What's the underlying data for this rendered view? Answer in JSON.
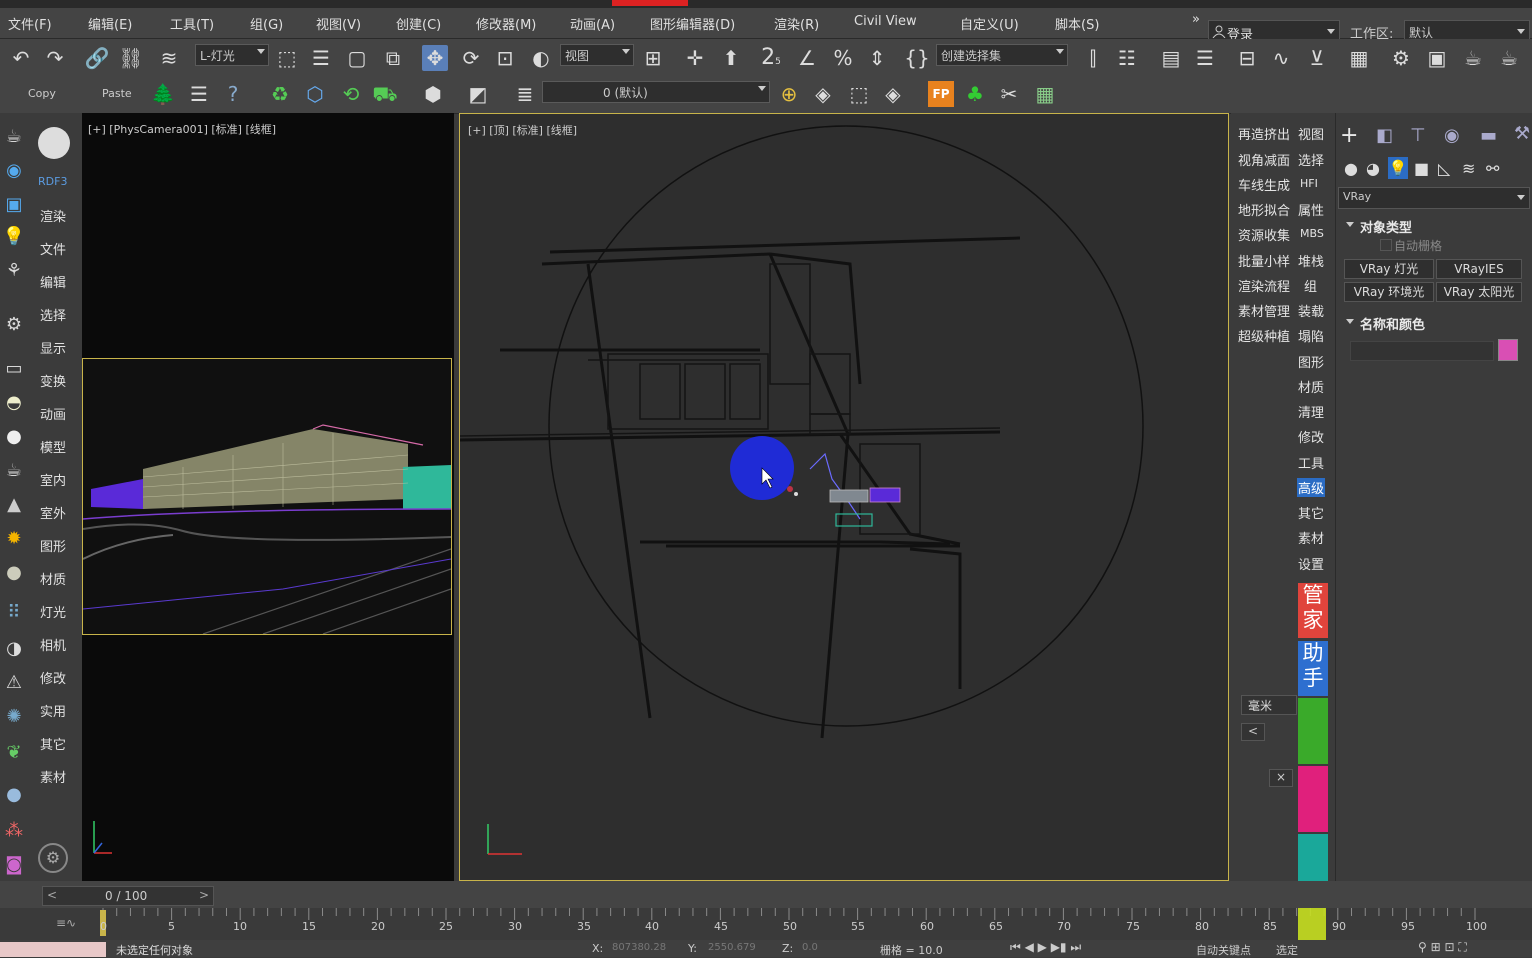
{
  "menu": {
    "items": [
      "文件(F)",
      "编辑(E)",
      "工具(T)",
      "组(G)",
      "视图(V)",
      "创建(C)",
      "修改器(M)",
      "动画(A)",
      "图形编辑器(D)",
      "渲染(R)",
      "Civil View",
      "自定义(U)",
      "脚本(S)"
    ],
    "overflow": "»",
    "login": "登录",
    "workspace_label": "工作区:",
    "workspace_value": "默认"
  },
  "toolbar": {
    "light_dropdown": "L-灯光",
    "view_dropdown": "视图",
    "selection_set": "创建选择集",
    "copy_label": "Copy",
    "paste_label": "Paste",
    "layer_dropdown": "0 (默认)",
    "snap_label": "2",
    "snap_sub": "5",
    "percent_label": "%",
    "fp_label": "FP"
  },
  "left_panel": {
    "rdf_label": "RDF3",
    "items": [
      "渲染",
      "文件",
      "编辑",
      "选择",
      "显示",
      "变换",
      "动画",
      "模型",
      "室内",
      "室外",
      "图形",
      "材质",
      "灯光",
      "相机",
      "修改",
      "实用",
      "其它",
      "素材"
    ]
  },
  "viewport_camera": {
    "label": "[+] [PhysCamera001] [标准] [线框]"
  },
  "viewport_top": {
    "label": "[+] [顶] [标准] [线框]"
  },
  "right_column": {
    "left_col": [
      "再造挤出",
      "视角减面",
      "车线生成",
      "地形拟合",
      "资源收集",
      "批量小样",
      "渲染流程",
      "素材管理",
      "超级种植"
    ],
    "right_col": [
      "视图",
      "选择",
      "HFI",
      "属性",
      "MBS",
      "堆栈",
      "组",
      "装载",
      "塌陷",
      "图形",
      "材质",
      "清理",
      "修改",
      "工具",
      "高级",
      "其它",
      "素材",
      "设置"
    ],
    "manager_chars": [
      "管",
      "家"
    ],
    "helper_chars": [
      "助",
      "手"
    ],
    "unit": "毫米",
    "collapse": "<",
    "close": "×"
  },
  "command_panel": {
    "renderer": "VRay",
    "object_type_title": "对象类型",
    "auto_grid": "自动栅格",
    "buttons": [
      "VRay 灯光",
      "VRayIES",
      "VRay 环境光",
      "VRay 太阳光"
    ],
    "name_color_title": "名称和颜色",
    "swatch_color": "#d94fb4"
  },
  "timeline": {
    "frame_counter": "0 / 100",
    "ticks": [
      "5",
      "10",
      "15",
      "20",
      "25",
      "30",
      "35",
      "40",
      "45",
      "50",
      "55",
      "60",
      "65",
      "70",
      "75",
      "80",
      "85",
      "90",
      "95",
      "100"
    ],
    "zero": "0"
  },
  "status": {
    "message": "未选定任何对象",
    "x_label": "X:",
    "x_value": "807380.28",
    "y_label": "Y:",
    "y_value": "2550.679",
    "z_label": "Z:",
    "z_value": "0.0",
    "grid": "栅格 = 10.0",
    "autokey": "自动关键点",
    "selected": "选定"
  },
  "colors": {
    "accent_blue": "#2b6cc4",
    "viewport_border": "#c8b44a",
    "cursor_dot": "#1f2bd6"
  }
}
